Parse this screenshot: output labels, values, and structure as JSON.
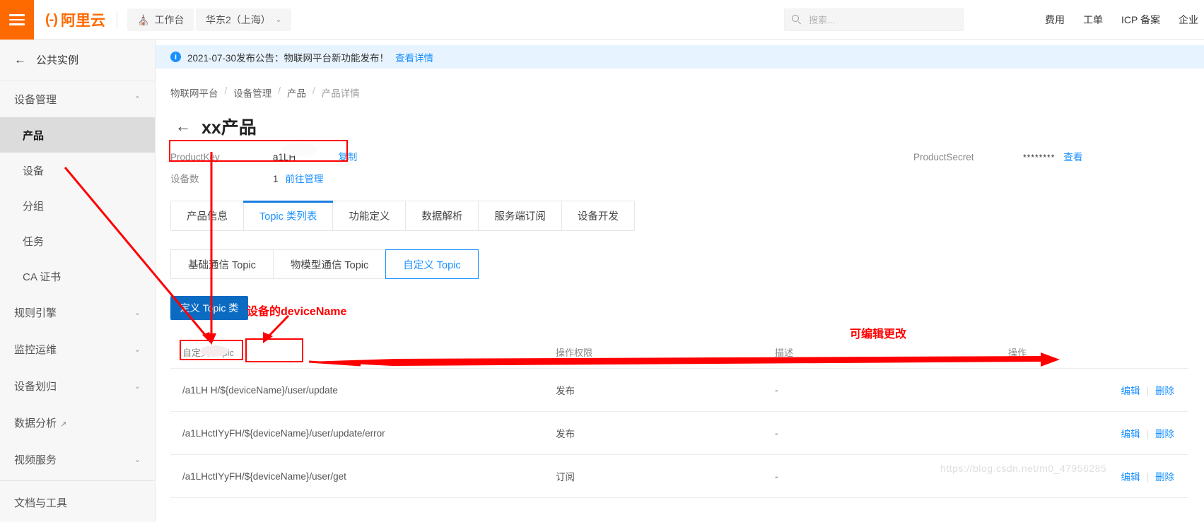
{
  "header": {
    "menu_icon": "hamburger-icon",
    "logo_mark": "(-)",
    "logo_text": "阿里云",
    "workbench": "工作台",
    "region": "华东2（上海）",
    "region_caret": "⌄",
    "search_placeholder": "搜索...",
    "search_value": "",
    "nav": [
      {
        "label": "费用"
      },
      {
        "label": "工单"
      },
      {
        "label": "ICP 备案"
      },
      {
        "label": "企业"
      }
    ]
  },
  "sidebar": {
    "back_label": "公共实例",
    "back_icon": "←",
    "groups": [
      {
        "label": "设备管理",
        "chevron": "⌃"
      }
    ],
    "items": [
      {
        "label": "产品",
        "active": true
      },
      {
        "label": "设备",
        "active": false
      },
      {
        "label": "分组",
        "active": false
      },
      {
        "label": "任务",
        "active": false
      },
      {
        "label": "CA 证书",
        "active": false
      }
    ],
    "collapsed_groups": [
      {
        "label": "规则引擎",
        "chevron": "⌄"
      },
      {
        "label": "监控运维",
        "chevron": "⌄"
      },
      {
        "label": "设备划归",
        "chevron": "⌄"
      },
      {
        "label": "数据分析",
        "chevron": "",
        "external": "↗"
      },
      {
        "label": "视频服务",
        "chevron": "⌄"
      }
    ],
    "doc_label": "文档与工具"
  },
  "notice": {
    "icon": "i",
    "text": "2021-07-30发布公告：物联网平台新功能发布！",
    "link": "查看详情"
  },
  "breadcrumb": {
    "items": [
      "物联网平台",
      "设备管理",
      "产品",
      "产品详情"
    ],
    "separator": "/"
  },
  "page": {
    "back_arrow": "←",
    "title": "xx产品",
    "product_key_label": "ProductKey",
    "product_key_value": "a1LH",
    "copy_label": "复制",
    "product_secret_label": "ProductSecret",
    "product_secret_value": "********",
    "view_label": "查看",
    "device_count_label": "设备数",
    "device_count_value": "1",
    "device_manage_link": "前往管理"
  },
  "tabs": [
    {
      "label": "产品信息",
      "active": false
    },
    {
      "label": "Topic 类列表",
      "active": true
    },
    {
      "label": "功能定义",
      "active": false
    },
    {
      "label": "数据解析",
      "active": false
    },
    {
      "label": "服务端订阅",
      "active": false
    },
    {
      "label": "设备开发",
      "active": false
    }
  ],
  "subtabs": [
    {
      "label": "基础通信 Topic",
      "active": false
    },
    {
      "label": "物模型通信 Topic",
      "active": false
    },
    {
      "label": "自定义 Topic",
      "active": true
    }
  ],
  "actions": {
    "define_topic": "定义 Topic 类"
  },
  "table": {
    "columns": [
      "自定义 Topic",
      "操作权限",
      "描述",
      "操作"
    ],
    "rows": [
      {
        "topic": "/a1LH        H/${deviceName}/user/update",
        "topic_prefix": "/a1LH",
        "topic_mid": "H/$",
        "topic_var": "{deviceName}",
        "topic_suffix": "/user/update",
        "permission": "发布",
        "description": "-",
        "edit": "编辑",
        "delete": "删除"
      },
      {
        "topic": "/a1LHctIYyFH/${deviceName}/user/update/error",
        "permission": "发布",
        "description": "-",
        "edit": "编辑",
        "delete": "删除"
      },
      {
        "topic": "/a1LHctIYyFH/${deviceName}/user/get",
        "permission": "订阅",
        "description": "-",
        "edit": "编辑",
        "delete": "删除"
      }
    ]
  },
  "annotations": {
    "device_name_label": "设备的deviceName",
    "editable_label": "可编辑更改",
    "color": "#ff0000"
  },
  "watermark": "https://blog.csdn.net/m0_47956285"
}
